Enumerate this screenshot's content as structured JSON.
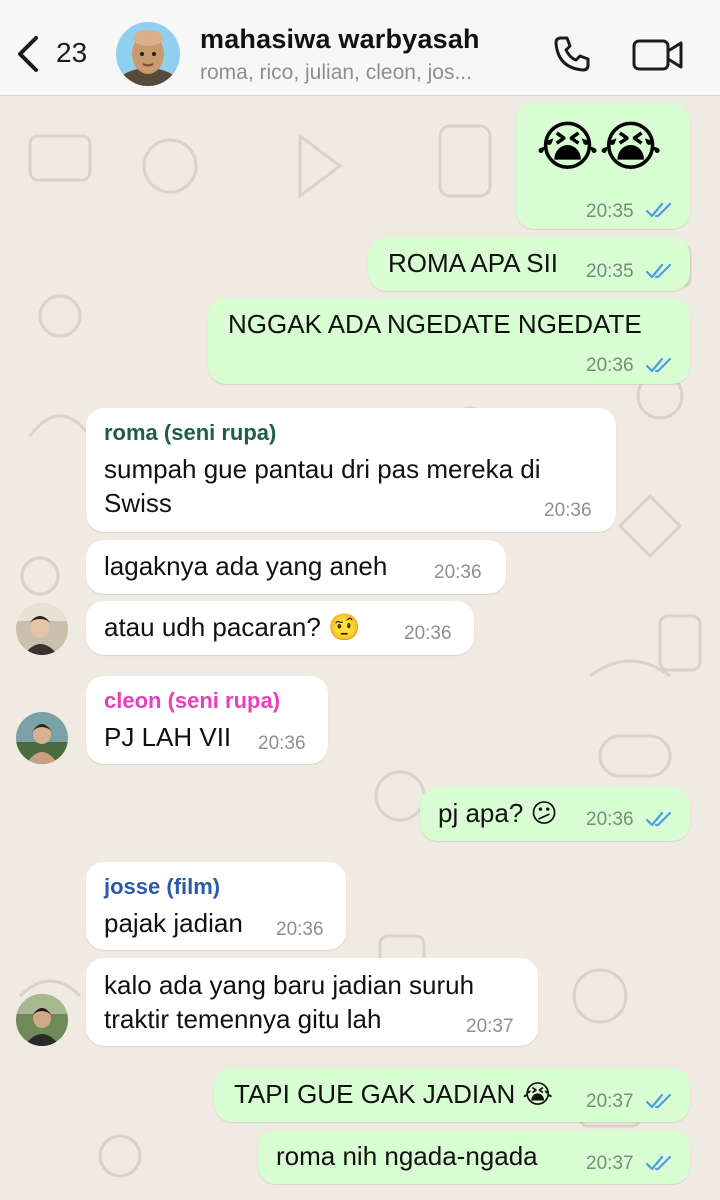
{
  "header": {
    "back_count": "23",
    "title": "mahasiwa warbyasah",
    "members": "roma, rico, julian, cleon, jos..."
  },
  "messages": [
    {
      "kind": "out",
      "text": "😭😭",
      "time": "20:35",
      "status": "read"
    },
    {
      "kind": "out",
      "text": "ROMA APA SII",
      "time": "20:35",
      "status": "read"
    },
    {
      "kind": "out",
      "text": "NGGAK ADA NGEDATE NGEDATE",
      "time": "20:36",
      "status": "read"
    },
    {
      "kind": "in",
      "sender": "roma (seni rupa)",
      "line1": "sumpah gue pantau dri pas mereka di",
      "line2": "Swiss",
      "time": "20:36"
    },
    {
      "kind": "in",
      "text": "lagaknya ada yang aneh",
      "time": "20:36"
    },
    {
      "kind": "in",
      "text": "atau udh pacaran? 🤨",
      "time": "20:36"
    },
    {
      "kind": "in",
      "sender": "cleon (seni rupa)",
      "text": "PJ LAH VII",
      "time": "20:36"
    },
    {
      "kind": "out",
      "text": "pj apa? 😕",
      "time": "20:36",
      "status": "read"
    },
    {
      "kind": "in",
      "sender": "josse (film)",
      "text": "pajak jadian",
      "time": "20:36"
    },
    {
      "kind": "in",
      "line1": "kalo ada yang baru jadian suruh",
      "line2": "traktir temennya gitu lah",
      "time": "20:37"
    },
    {
      "kind": "out",
      "text": "TAPI GUE GAK JADIAN 😭",
      "time": "20:37",
      "status": "read"
    },
    {
      "kind": "out",
      "text": "roma nih ngada-ngada",
      "time": "20:37",
      "status": "read"
    }
  ],
  "colors": {
    "roma": "#1f5c4a",
    "cleon": "#e83fbf",
    "josse": "#2a5aa8",
    "ticks": "#4f9be8"
  }
}
